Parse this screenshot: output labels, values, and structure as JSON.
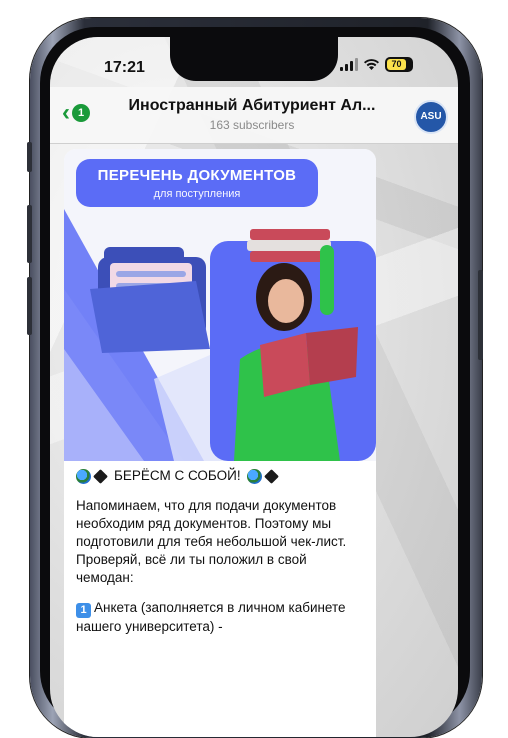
{
  "status_bar": {
    "time": "17:21",
    "battery": "70"
  },
  "header": {
    "back_badge": "1",
    "title": "Иностранный Абитуриент Ал...",
    "subtitle": "163 subscribers",
    "avatar_text": "ASU"
  },
  "post": {
    "image_title": "ПЕРЕЧЕНЬ ДОКУМЕНТОВ",
    "image_subtitle": "для поступления",
    "heading": "БЕРЁСМ С СОБОЙ!",
    "paragraph": "Напоминаем, что для подачи документов необходим ряд документов. Поэтому мы подготовили для тебя небольшой чек-лист. Проверяй, всё ли ты положил в свой чемодан:",
    "item1_num": "1",
    "item1_text": "Анкета (заполняется в личном кабинете нашего университета) -"
  },
  "colors": {
    "accent_green": "#1a9a3a",
    "banner_blue": "#5b6cf6",
    "avatar_blue": "#2457a8"
  },
  "icons": [
    "chevron-left-icon",
    "signal-icon",
    "wifi-icon",
    "battery-icon",
    "globe-icon",
    "graduation-cap-icon",
    "keycap-one-icon"
  ]
}
